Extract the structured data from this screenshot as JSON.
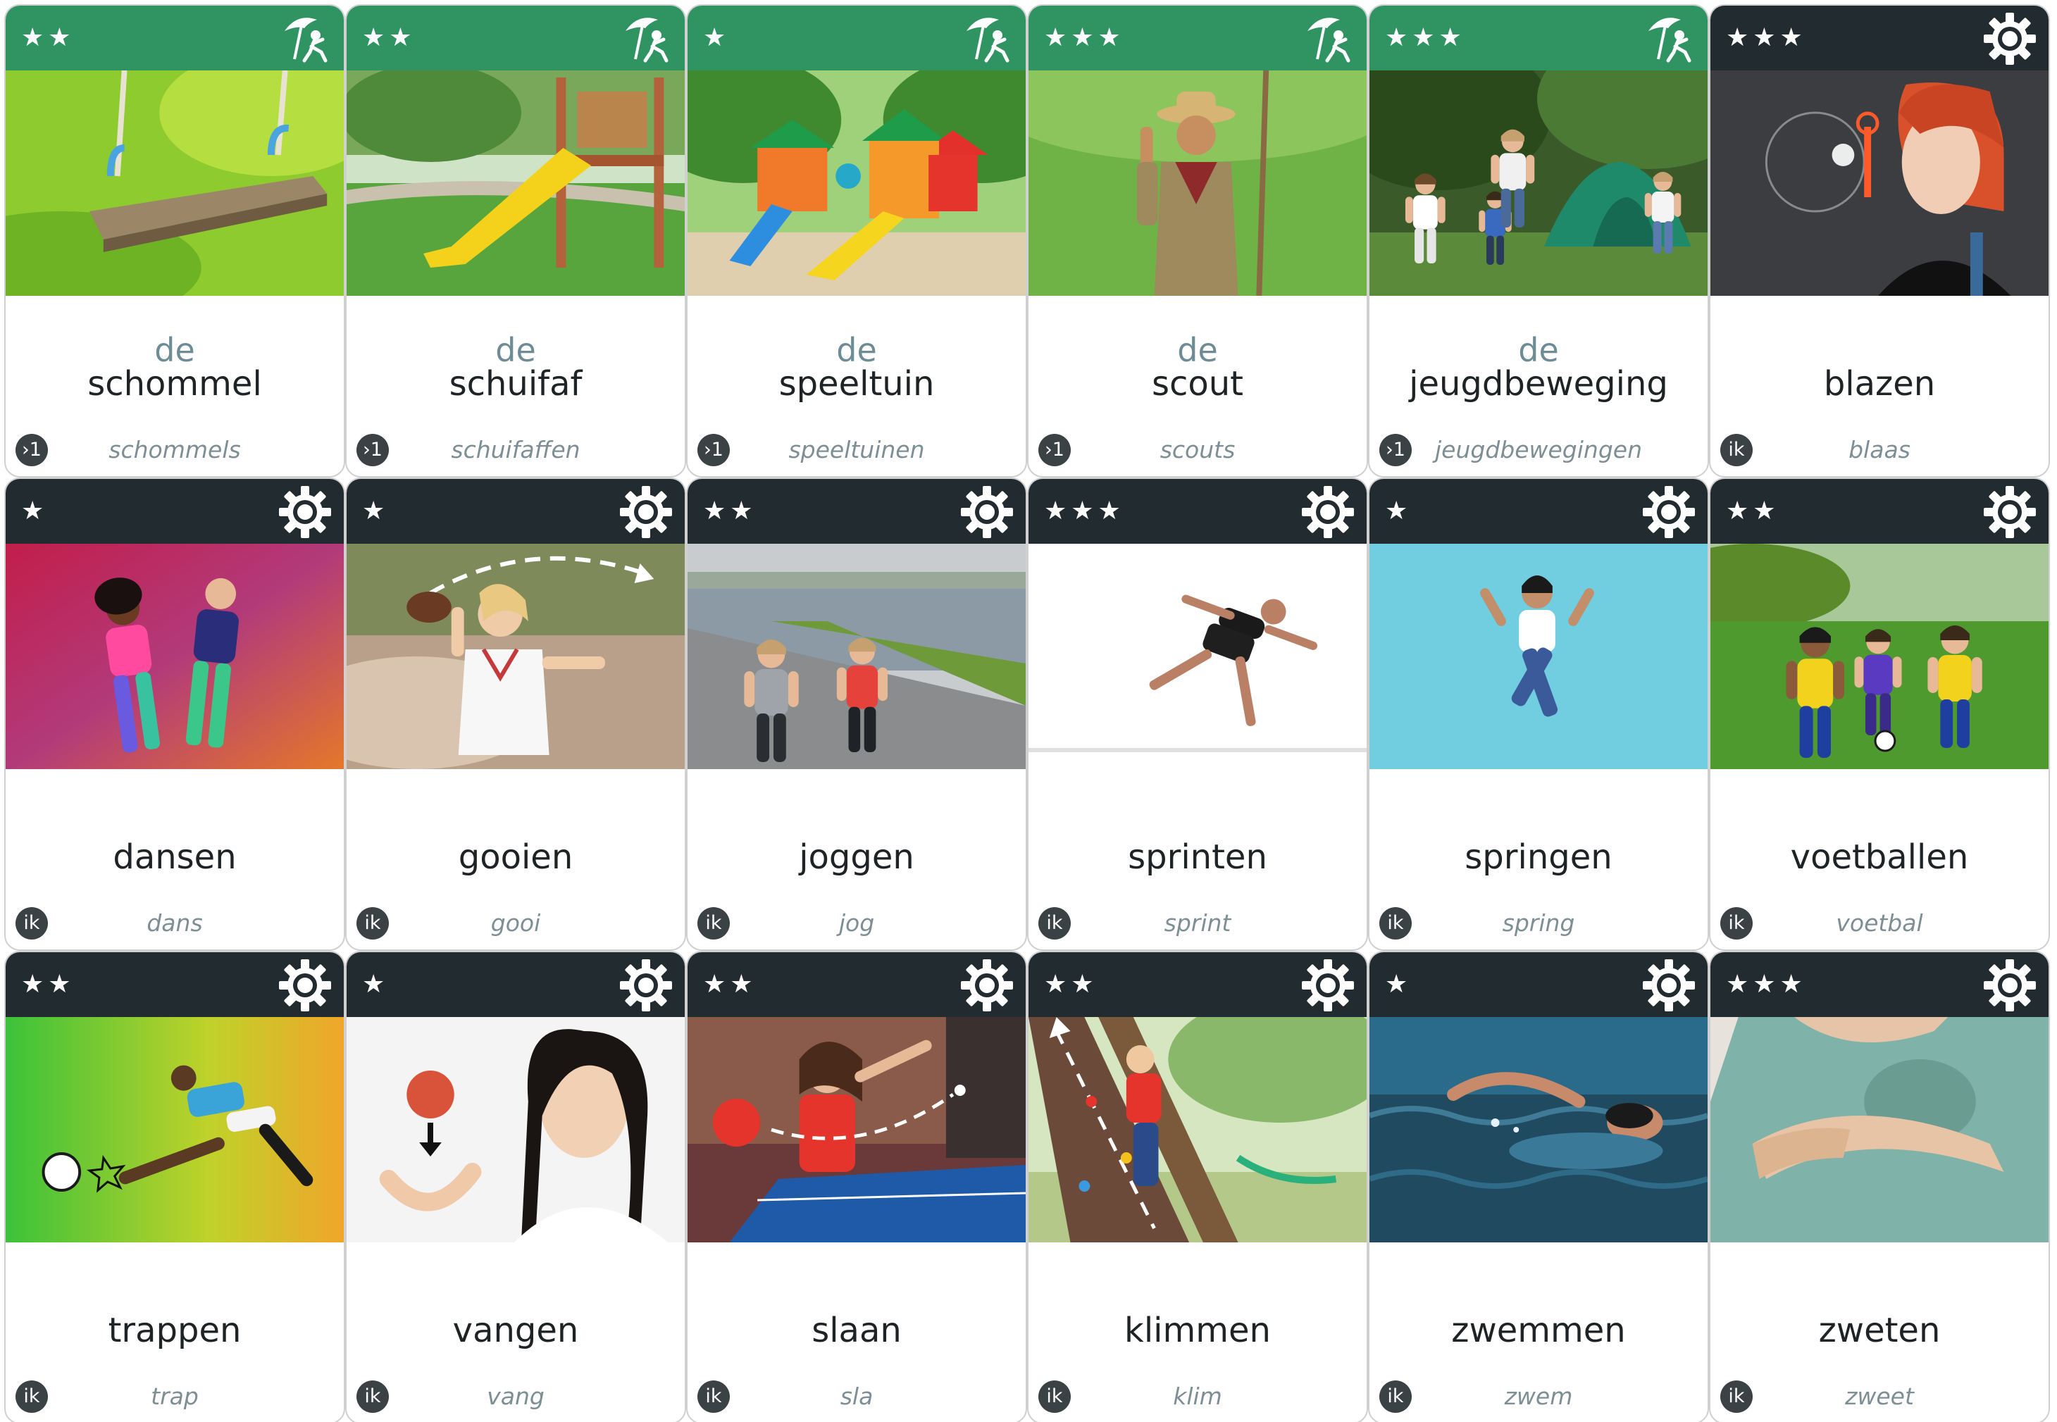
{
  "colors": {
    "noun_header": "#2f9462",
    "verb_header": "#222b30",
    "article_text": "#6e8c95",
    "word_text": "#1e2326",
    "form_text": "#7d8f95",
    "badge_bg": "#3a4246"
  },
  "cards": [
    {
      "kind": "noun",
      "stars": "★★",
      "icon": "beach-play-icon",
      "article": "de",
      "word": "schommel",
      "badge": "›1",
      "form": "schommels",
      "photo": "swing-photo"
    },
    {
      "kind": "noun",
      "stars": "★★",
      "icon": "beach-play-icon",
      "article": "de",
      "word": "schuifaf",
      "badge": "›1",
      "form": "schuifaffen",
      "photo": "slide-photo"
    },
    {
      "kind": "noun",
      "stars": "★",
      "icon": "beach-play-icon",
      "article": "de",
      "word": "speeltuin",
      "badge": "›1",
      "form": "speeltuinen",
      "photo": "playground-photo"
    },
    {
      "kind": "noun",
      "stars": "★★★",
      "icon": "beach-play-icon",
      "article": "de",
      "word": "scout",
      "badge": "›1",
      "form": "scouts",
      "photo": "scout-photo"
    },
    {
      "kind": "noun",
      "stars": "★★★",
      "icon": "beach-play-icon",
      "article": "de",
      "word": "jeugdbeweging",
      "badge": "›1",
      "form": "jeugdbewegingen",
      "photo": "youth-camp-photo"
    },
    {
      "kind": "verb",
      "stars": "★★★",
      "icon": "gear-icon",
      "article": "",
      "word": "blazen",
      "badge": "ik",
      "form": "blaas",
      "photo": "bubble-blowing-photo"
    },
    {
      "kind": "verb",
      "stars": "★",
      "icon": "gear-icon",
      "article": "",
      "word": "dansen",
      "badge": "ik",
      "form": "dans",
      "photo": "dancing-photo"
    },
    {
      "kind": "verb",
      "stars": "★",
      "icon": "gear-icon",
      "article": "",
      "word": "gooien",
      "badge": "ik",
      "form": "gooi",
      "photo": "throwing-photo"
    },
    {
      "kind": "verb",
      "stars": "★★",
      "icon": "gear-icon",
      "article": "",
      "word": "joggen",
      "badge": "ik",
      "form": "jog",
      "photo": "jogging-photo"
    },
    {
      "kind": "verb",
      "stars": "★★★",
      "icon": "gear-icon",
      "article": "",
      "word": "sprinten",
      "badge": "ik",
      "form": "sprint",
      "photo": "sprinting-photo"
    },
    {
      "kind": "verb",
      "stars": "★",
      "icon": "gear-icon",
      "article": "",
      "word": "springen",
      "badge": "ik",
      "form": "spring",
      "photo": "jumping-photo"
    },
    {
      "kind": "verb",
      "stars": "★★",
      "icon": "gear-icon",
      "article": "",
      "word": "voetballen",
      "badge": "ik",
      "form": "voetbal",
      "photo": "football-photo"
    },
    {
      "kind": "verb",
      "stars": "★★",
      "icon": "gear-icon",
      "article": "",
      "word": "trappen",
      "badge": "ik",
      "form": "trap",
      "photo": "kicking-photo"
    },
    {
      "kind": "verb",
      "stars": "★",
      "icon": "gear-icon",
      "article": "",
      "word": "vangen",
      "badge": "ik",
      "form": "vang",
      "photo": "catching-photo"
    },
    {
      "kind": "verb",
      "stars": "★★",
      "icon": "gear-icon",
      "article": "",
      "word": "slaan",
      "badge": "ik",
      "form": "sla",
      "photo": "table-tennis-photo"
    },
    {
      "kind": "verb",
      "stars": "★★",
      "icon": "gear-icon",
      "article": "",
      "word": "klimmen",
      "badge": "ik",
      "form": "klim",
      "photo": "climbing-photo"
    },
    {
      "kind": "verb",
      "stars": "★",
      "icon": "gear-icon",
      "article": "",
      "word": "zwemmen",
      "badge": "ik",
      "form": "zwem",
      "photo": "swimming-photo"
    },
    {
      "kind": "verb",
      "stars": "★★★",
      "icon": "gear-icon",
      "article": "",
      "word": "zweten",
      "badge": "ik",
      "form": "zweet",
      "photo": "sweating-photo"
    }
  ]
}
